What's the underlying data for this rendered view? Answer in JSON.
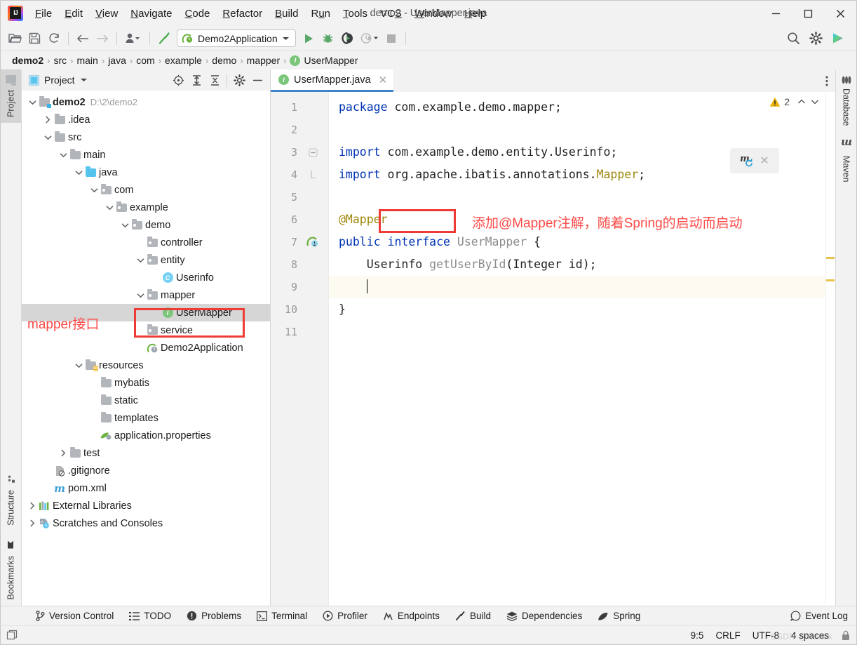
{
  "window": {
    "title": "demo2 - UserMapper.java",
    "minimize": "—",
    "maximize": "□",
    "close": "✕"
  },
  "menubar": [
    {
      "label": "File",
      "mnemonic": "F"
    },
    {
      "label": "Edit",
      "mnemonic": "E"
    },
    {
      "label": "View",
      "mnemonic": "V"
    },
    {
      "label": "Navigate",
      "mnemonic": "N"
    },
    {
      "label": "Code",
      "mnemonic": "C"
    },
    {
      "label": "Refactor",
      "mnemonic": "R"
    },
    {
      "label": "Build",
      "mnemonic": "B"
    },
    {
      "label": "Run",
      "mnemonic": "u"
    },
    {
      "label": "Tools",
      "mnemonic": "T"
    },
    {
      "label": "VCS",
      "mnemonic": "S"
    },
    {
      "label": "Window",
      "mnemonic": "W"
    },
    {
      "label": "Help",
      "mnemonic": "H"
    }
  ],
  "toolbar": {
    "open_icon": "open-folder-icon",
    "save_icon": "save-icon",
    "sync_icon": "sync-icon",
    "back_icon": "back-arrow-icon",
    "forward_icon": "forward-arrow-icon",
    "profile_icon": "user-profile-icon",
    "build_icon": "hammer-icon",
    "run_config": "Demo2Application",
    "run_icon": "run-icon",
    "debug_icon": "debug-icon",
    "run_coverage_icon": "run-with-coverage-icon",
    "profiler_icon": "profiler-clock-icon",
    "stop_icon": "stop-icon",
    "search_icon": "search-icon",
    "settings_icon": "gear-icon",
    "ide_assistant_icon": "ai-assistant-icon"
  },
  "breadcrumb": [
    {
      "label": "demo2",
      "bold": true
    },
    {
      "label": "src",
      "bold": false
    },
    {
      "label": "main",
      "bold": false
    },
    {
      "label": "java",
      "bold": false
    },
    {
      "label": "com",
      "bold": false
    },
    {
      "label": "example",
      "bold": false
    },
    {
      "label": "demo",
      "bold": false
    },
    {
      "label": "mapper",
      "bold": false
    },
    {
      "label": "UserMapper",
      "bold": false,
      "icon": "interface-icon"
    }
  ],
  "left_strip": {
    "project": "Project",
    "structure": "Structure",
    "bookmarks": "Bookmarks"
  },
  "right_strip": {
    "database": "Database",
    "maven": "Maven"
  },
  "project_panel": {
    "title": "Project",
    "dropdown_icon": "chevron-down-icon",
    "actions": [
      "select-opened-file-icon",
      "expand-all-icon",
      "collapse-all-icon",
      "gear-icon",
      "hide-icon"
    ],
    "tree": [
      {
        "label": "demo2",
        "path": "D:\\2\\demo2",
        "indent": 0,
        "twist": "open",
        "icon": "module-folder",
        "bold": true
      },
      {
        "label": ".idea",
        "indent": 1,
        "twist": "closed",
        "icon": "folder"
      },
      {
        "label": "src",
        "indent": 1,
        "twist": "open",
        "icon": "folder"
      },
      {
        "label": "main",
        "indent": 2,
        "twist": "open",
        "icon": "folder"
      },
      {
        "label": "java",
        "indent": 3,
        "twist": "open",
        "icon": "source-folder"
      },
      {
        "label": "com",
        "indent": 4,
        "twist": "open",
        "icon": "package-folder"
      },
      {
        "label": "example",
        "indent": 5,
        "twist": "open",
        "icon": "package-folder"
      },
      {
        "label": "demo",
        "indent": 6,
        "twist": "open",
        "icon": "package-folder"
      },
      {
        "label": "controller",
        "indent": 7,
        "twist": "none",
        "icon": "package-folder"
      },
      {
        "label": "entity",
        "indent": 7,
        "twist": "open",
        "icon": "package-folder"
      },
      {
        "label": "Userinfo",
        "indent": 8,
        "twist": "none",
        "icon": "class-icon"
      },
      {
        "label": "mapper",
        "indent": 7,
        "twist": "open",
        "icon": "package-folder"
      },
      {
        "label": "UserMapper",
        "indent": 8,
        "twist": "none",
        "icon": "interface-icon",
        "selected": true
      },
      {
        "label": "service",
        "indent": 7,
        "twist": "none",
        "icon": "package-folder"
      },
      {
        "label": "Demo2Application",
        "indent": 7,
        "twist": "none",
        "icon": "spring-class-icon"
      },
      {
        "label": "resources",
        "indent": 3,
        "twist": "open",
        "icon": "resource-folder"
      },
      {
        "label": "mybatis",
        "indent": 4,
        "twist": "none",
        "icon": "folder"
      },
      {
        "label": "static",
        "indent": 4,
        "twist": "none",
        "icon": "folder"
      },
      {
        "label": "templates",
        "indent": 4,
        "twist": "none",
        "icon": "folder"
      },
      {
        "label": "application.properties",
        "indent": 4,
        "twist": "none",
        "icon": "spring-properties-icon"
      },
      {
        "label": "test",
        "indent": 2,
        "twist": "closed",
        "icon": "folder"
      },
      {
        "label": ".gitignore",
        "indent": 1,
        "twist": "none",
        "icon": "gitignore-icon"
      },
      {
        "label": "pom.xml",
        "indent": 1,
        "twist": "none",
        "icon": "maven-icon"
      },
      {
        "label": "External Libraries",
        "indent": 0,
        "twist": "closed",
        "icon": "libraries-icon"
      },
      {
        "label": "Scratches and Consoles",
        "indent": 0,
        "twist": "closed",
        "icon": "scratches-icon"
      }
    ]
  },
  "editor": {
    "tab": {
      "label": "UserMapper.java",
      "icon": "interface-icon",
      "close": "✕"
    },
    "tab_options_icon": "more-options-icon",
    "inspection": {
      "warning_icon": "warning-triangle-icon",
      "count": "2",
      "prev": "⌃",
      "next": "⌄"
    },
    "maven_popup": {
      "icon": "maven-reload-icon",
      "close": "✕"
    },
    "gutter_run_icon": "spring-bean-gutter-icon",
    "lines": [
      {
        "n": "1",
        "tokens": [
          {
            "t": "package ",
            "c": "kw"
          },
          {
            "t": "com.example.demo.mapper;",
            "c": "plain"
          }
        ]
      },
      {
        "n": "2",
        "tokens": []
      },
      {
        "n": "3",
        "fold": "minus",
        "tokens": [
          {
            "t": "import ",
            "c": "kw"
          },
          {
            "t": "com.example.demo.entity.Userinfo;",
            "c": "plain"
          }
        ]
      },
      {
        "n": "4",
        "fold": "line",
        "tokens": [
          {
            "t": "import ",
            "c": "kw"
          },
          {
            "t": "org.apache.ibatis.annotations.",
            "c": "plain"
          },
          {
            "t": "Mapper",
            "c": "ann"
          },
          {
            "t": ";",
            "c": "plain"
          }
        ]
      },
      {
        "n": "5",
        "tokens": []
      },
      {
        "n": "6",
        "tokens": [
          {
            "t": "@Mapper",
            "c": "ann"
          }
        ]
      },
      {
        "n": "7",
        "bean": true,
        "tokens": [
          {
            "t": "public ",
            "c": "kw"
          },
          {
            "t": "interface ",
            "c": "kw"
          },
          {
            "t": "UserMapper ",
            "c": "dim"
          },
          {
            "t": "{",
            "c": "plain"
          }
        ]
      },
      {
        "n": "8",
        "tokens": [
          {
            "t": "    Userinfo ",
            "c": "plain"
          },
          {
            "t": "getUserById",
            "c": "meth"
          },
          {
            "t": "(Integer id);",
            "c": "plain"
          }
        ]
      },
      {
        "n": "9",
        "highlight": true,
        "caret": true,
        "tokens": [
          {
            "t": "    ",
            "c": "plain"
          }
        ]
      },
      {
        "n": "10",
        "tokens": [
          {
            "t": "}",
            "c": "plain"
          }
        ]
      },
      {
        "n": "11",
        "tokens": []
      }
    ]
  },
  "annotations": {
    "mapper_note": "添加@Mapper注解，随着Spring的启动而启动",
    "tree_note": "mapper接口",
    "box_color": "#ef3b36",
    "text_color": "#fc4a47"
  },
  "tool_windows": [
    {
      "label": "Version Control",
      "icon": "branch-icon"
    },
    {
      "label": "TODO",
      "icon": "todo-list-icon"
    },
    {
      "label": "Problems",
      "icon": "problems-icon"
    },
    {
      "label": "Terminal",
      "icon": "terminal-icon"
    },
    {
      "label": "Profiler",
      "icon": "profiler-icon"
    },
    {
      "label": "Endpoints",
      "icon": "endpoints-icon"
    },
    {
      "label": "Build",
      "icon": "hammer-icon"
    },
    {
      "label": "Dependencies",
      "icon": "dependencies-icon"
    },
    {
      "label": "Spring",
      "icon": "spring-leaf-icon"
    }
  ],
  "event_log": {
    "label": "Event Log",
    "icon": "event-log-icon"
  },
  "statusbar": {
    "left_icon": "window-layout-icon",
    "caret_position": "9:5",
    "line_separator": "CRLF",
    "encoding": "UTF-8",
    "indent": "4 spaces",
    "lock_icon": "read-only-lock-icon",
    "watermark": "CSDN @wzxbk"
  }
}
